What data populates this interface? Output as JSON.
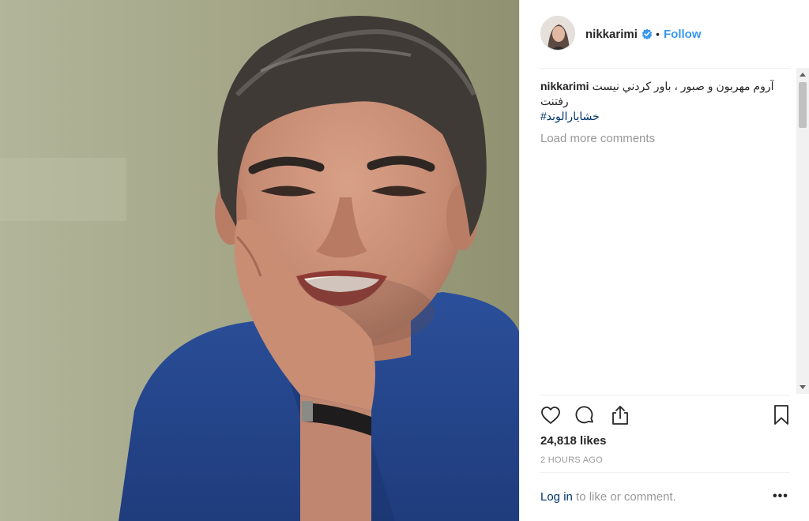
{
  "post": {
    "username": "nikkarimi",
    "follow_label": "Follow",
    "separator": "•",
    "verified": true,
    "accent_color": "#3897f0"
  },
  "caption": {
    "username": "nikkarimi",
    "text": "آروم مهربون و صبور ، باور كردني نيست",
    "text_line2": "رفتنت",
    "hashtag": "#خشایارالوند"
  },
  "comments": {
    "load_more_label": "Load more comments"
  },
  "actions": {
    "like_icon": "heart-icon",
    "comment_icon": "comment-icon",
    "share_icon": "share-icon",
    "save_icon": "bookmark-icon"
  },
  "stats": {
    "likes_label": "24,818 likes",
    "time_label": "2 HOURS AGO"
  },
  "footer": {
    "login_link": "Log in",
    "login_rest": " to like or comment.",
    "more_label": "•••"
  }
}
